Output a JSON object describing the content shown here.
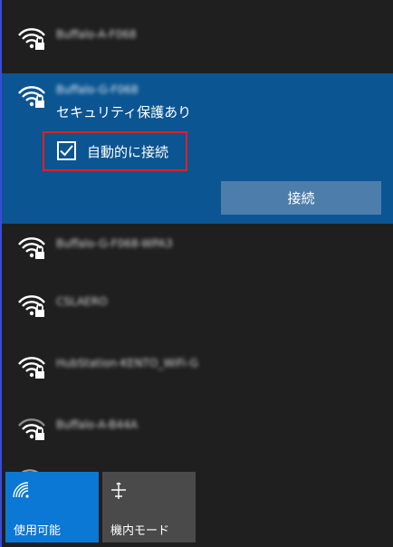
{
  "networks": [
    {
      "ssid": "Buffalo-A-F068",
      "icon": "wifi-secured-icon"
    },
    {
      "ssid": "Buffalo-G-F068-WPA3",
      "icon": "wifi-secured-icon"
    },
    {
      "ssid": "CSLAERO",
      "icon": "wifi-secured-icon"
    },
    {
      "ssid": "HubStation-KENTO_WiFi-G",
      "icon": "wifi-secured-icon"
    },
    {
      "ssid": "Buffalo-A-B44A",
      "icon": "wifi-secured-icon"
    }
  ],
  "selected": {
    "ssid": "Buffalo-G-F068",
    "status": "セキュリティ保護あり",
    "auto_connect_label": "自動的に接続",
    "auto_connect_checked": true,
    "connect_label": "接続"
  },
  "quick_actions": [
    {
      "label": "使用可能",
      "icon": "wifi-icon",
      "active": true,
      "color": "#0a78d4"
    },
    {
      "label": "機内モード",
      "icon": "airplane-icon",
      "active": false,
      "color": "#4a4a4a"
    }
  ],
  "colors": {
    "background": "#1f1f1f",
    "selected_background": "#0b5592",
    "connect_button": "#4d7eab",
    "highlight_border": "#e02020",
    "accent": "#0a78d4"
  }
}
